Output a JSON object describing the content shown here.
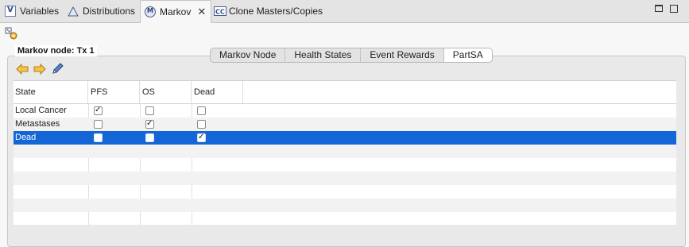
{
  "tabs": [
    {
      "label": "Variables",
      "icon": "variables-icon",
      "active": false
    },
    {
      "label": "Distributions",
      "icon": "distributions-icon",
      "active": false
    },
    {
      "label": "Markov",
      "icon": "markov-icon",
      "active": true
    },
    {
      "label": "Clone Masters/Copies",
      "icon": "clone-masters-icon",
      "active": false
    }
  ],
  "close_glyph": "✕",
  "subtabs": [
    {
      "label": "Markov Node",
      "active": false
    },
    {
      "label": "Health States",
      "active": false
    },
    {
      "label": "Event Rewards",
      "active": false
    },
    {
      "label": "PartSA",
      "active": true
    }
  ],
  "node_label": "Markov node: Tx 1",
  "table": {
    "columns": [
      "State",
      "PFS",
      "OS",
      "Dead"
    ],
    "rows": [
      {
        "state": "Local Cancer",
        "pfs": true,
        "os": false,
        "dead": false,
        "selected": false
      },
      {
        "state": "Metastases",
        "pfs": false,
        "os": true,
        "dead": false,
        "selected": false
      },
      {
        "state": "Dead",
        "pfs": false,
        "os": false,
        "dead": true,
        "selected": true
      }
    ]
  },
  "check_glyph": "✓",
  "colors": {
    "selection": "#1465d6",
    "accent_back": "#f5a623"
  }
}
